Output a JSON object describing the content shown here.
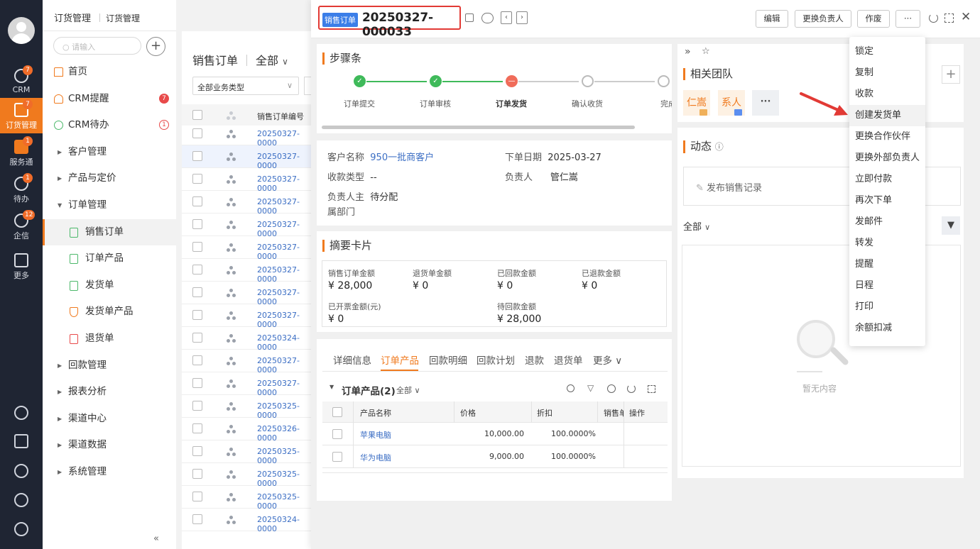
{
  "rail": {
    "items": [
      {
        "label": "CRM",
        "badge": "7"
      },
      {
        "label": "订货管理",
        "badge": "7"
      },
      {
        "label": "服务通",
        "badge": "1"
      },
      {
        "label": "待办",
        "badge": "1"
      },
      {
        "label": "企信",
        "badge": "12"
      },
      {
        "label": "更多",
        "badge": ""
      }
    ]
  },
  "nav": {
    "breadcrumb_app": "订货管理",
    "breadcrumb_page": "订货管理",
    "search_placeholder": "请输入",
    "plus": "+",
    "items": [
      {
        "label": "首页"
      },
      {
        "label": "CRM提醒",
        "badge": "7"
      },
      {
        "label": "CRM待办",
        "badge": "1"
      },
      {
        "label": "客户管理"
      },
      {
        "label": "产品与定价"
      },
      {
        "label": "订单管理"
      },
      {
        "label": "销售订单"
      },
      {
        "label": "订单产品"
      },
      {
        "label": "发货单"
      },
      {
        "label": "发货单产品"
      },
      {
        "label": "退货单"
      },
      {
        "label": "回款管理"
      },
      {
        "label": "报表分析"
      },
      {
        "label": "渠道中心"
      },
      {
        "label": "渠道数据"
      },
      {
        "label": "系统管理"
      }
    ],
    "collapse": "«"
  },
  "list": {
    "title": "销售订单",
    "scope": "全部",
    "filter": "全部业务类型",
    "col_number": "销售订单编号",
    "rows": [
      "20250327-0000",
      "20250327-0000",
      "20250327-0000",
      "20250327-0000",
      "20250327-0000",
      "20250327-0000",
      "20250327-0000",
      "20250327-0000",
      "20250327-0000",
      "20250324-0000",
      "20250327-0000",
      "20250327-0000",
      "20250325-0000",
      "20250326-0000",
      "20250325-0000",
      "20250325-0000",
      "20250325-0000",
      "20250324-0000"
    ]
  },
  "detail": {
    "tag": "销售订单",
    "number": "20250327-000033",
    "buttons": {
      "edit": "编辑",
      "change_owner": "更换负责人",
      "void": "作废",
      "more": "···"
    },
    "steps_title": "步骤条",
    "steps": [
      {
        "label": "订单提交",
        "state": "done"
      },
      {
        "label": "订单审核",
        "state": "done"
      },
      {
        "label": "订单发货",
        "state": "current"
      },
      {
        "label": "确认收货",
        "state": "todo"
      },
      {
        "label": "完成",
        "state": "todo"
      }
    ],
    "info": {
      "customer_k": "客户名称",
      "customer_v": "950一批商客户",
      "date_k": "下单日期",
      "date_v": "2025-03-27",
      "paytype_k": "收款类型",
      "paytype_v": "--",
      "owner_k": "负责人",
      "owner_v": "管仁嵩",
      "dept_k1": "负责人主",
      "dept_k2": "属部门",
      "dept_v": "待分配"
    },
    "summary_title": "摘要卡片",
    "summary": [
      {
        "label": "销售订单金额",
        "value": "¥ 28,000"
      },
      {
        "label": "退货单金额",
        "value": "¥ 0"
      },
      {
        "label": "已回款金额",
        "value": "¥ 0"
      },
      {
        "label": "已退款金额",
        "value": "¥ 0"
      },
      {
        "label": "已开票金额(元)",
        "value": "¥ 0"
      },
      {
        "label": "待回款金额",
        "value": "¥ 28,000"
      }
    ],
    "tabs": [
      "详细信息",
      "订单产品",
      "回款明细",
      "回款计划",
      "退款",
      "退货单",
      "更多"
    ],
    "products_title": "订单产品(2)",
    "products_scope": "全部",
    "table_headers": [
      "产品名称",
      "价格",
      "折扣",
      "销售单",
      "操作"
    ],
    "products": [
      {
        "name": "苹果电脑",
        "price": "10,000.00",
        "discount": "100.0000%"
      },
      {
        "name": "华为电脑",
        "price": "9,000.00",
        "discount": "100.0000%"
      }
    ]
  },
  "right": {
    "team_title": "相关团队",
    "team": [
      "仁嵩",
      "系人"
    ],
    "team_more": "···",
    "plus": "+",
    "activity_title": "动态",
    "publish": "发布销售记录",
    "filter_all": "全部",
    "empty": "暂无内容"
  },
  "menu": {
    "items": [
      "锁定",
      "复制",
      "收款",
      "创建发货单",
      "更换合作伙伴",
      "更换外部负责人",
      "立即付款",
      "再次下单",
      "发邮件",
      "转发",
      "提醒",
      "日程",
      "打印",
      "余额扣减"
    ],
    "highlight_index": 3
  },
  "colors": {
    "accent": "#f07a1e",
    "link": "#3b6ec4",
    "arrow": "#e23a35"
  }
}
